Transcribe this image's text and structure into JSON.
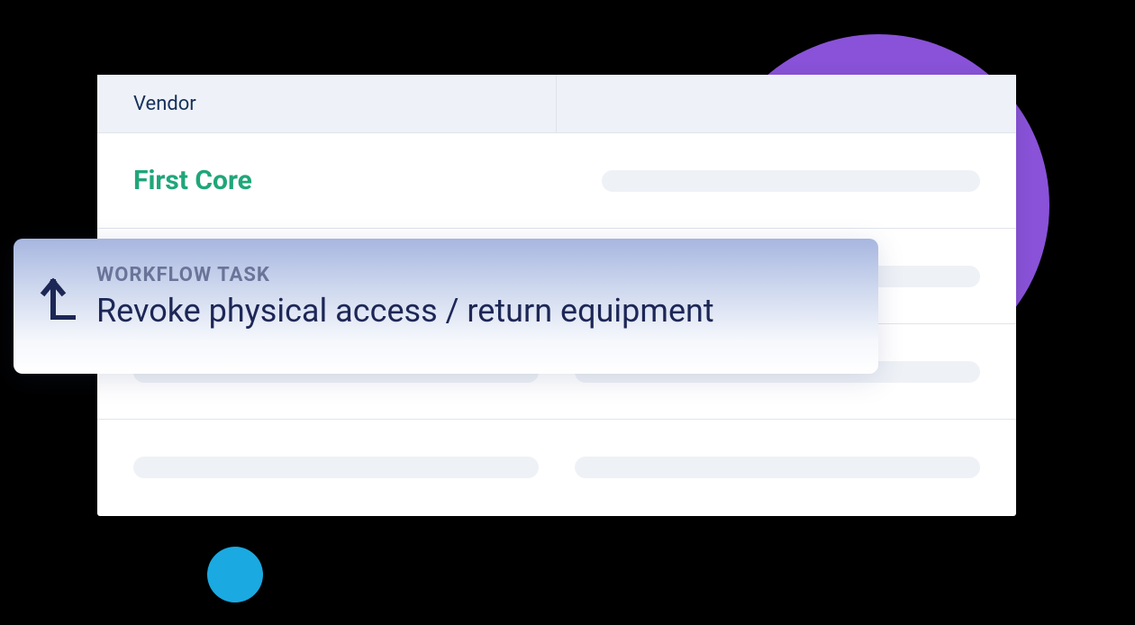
{
  "colors": {
    "purple": "#8952d8",
    "blue": "#1ba9e1",
    "green": "#1fa67a",
    "dark_navy": "#1d2756"
  },
  "panel": {
    "header": {
      "left_label": "Vendor",
      "right_label": ""
    },
    "rows": [
      {
        "vendor_name": "First Core"
      }
    ]
  },
  "workflow_card": {
    "label": "WORKFLOW TASK",
    "title": "Revoke physical access / return equipment"
  }
}
